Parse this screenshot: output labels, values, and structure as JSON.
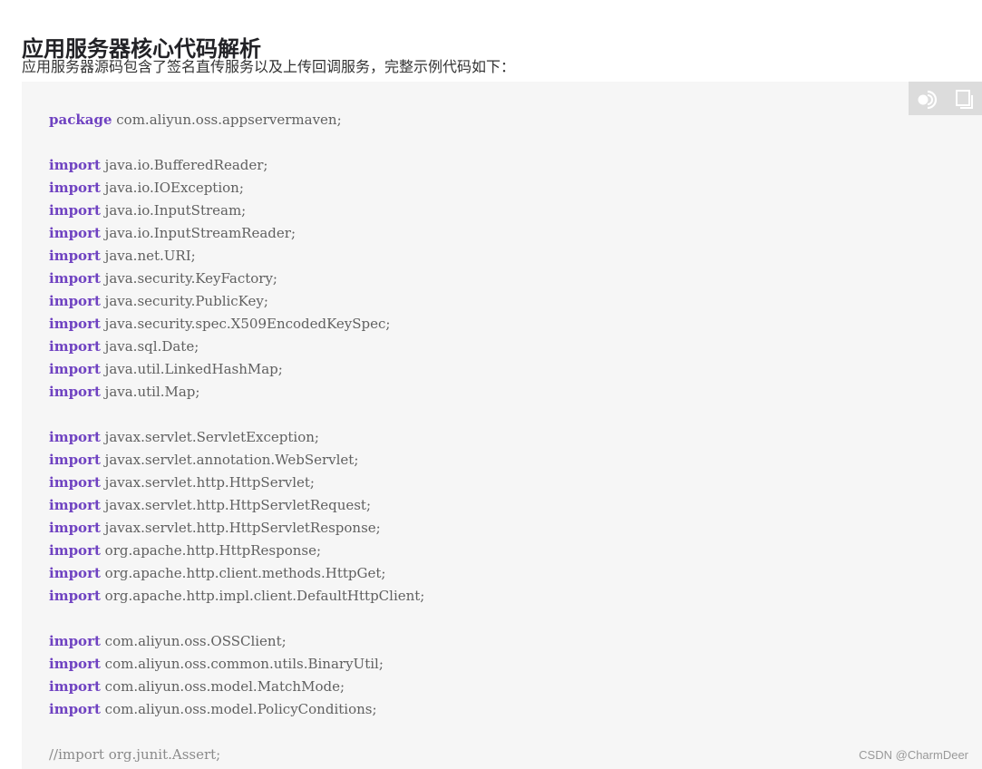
{
  "article": {
    "heading": "应用服务器核心代码解析",
    "intro": "应用服务器源码包含了签名直传服务以及上传回调服务，完整示例代码如下："
  },
  "code_block": {
    "language": "java",
    "toolbar": {
      "run_icon": "run-icon",
      "copy_icon": "copy-icon"
    },
    "colors": {
      "background": "#f6f6f6",
      "keyword": "#6f42c1",
      "text": "#606060",
      "comment": "#8a8a8a"
    },
    "lines": [
      {
        "keyword": "package",
        "text": " com.aliyun.oss.appservermaven;"
      },
      {
        "keyword": "",
        "text": ""
      },
      {
        "keyword": "import",
        "text": " java.io.BufferedReader;"
      },
      {
        "keyword": "import",
        "text": " java.io.IOException;"
      },
      {
        "keyword": "import",
        "text": " java.io.InputStream;"
      },
      {
        "keyword": "import",
        "text": " java.io.InputStreamReader;"
      },
      {
        "keyword": "import",
        "text": " java.net.URI;"
      },
      {
        "keyword": "import",
        "text": " java.security.KeyFactory;"
      },
      {
        "keyword": "import",
        "text": " java.security.PublicKey;"
      },
      {
        "keyword": "import",
        "text": " java.security.spec.X509EncodedKeySpec;"
      },
      {
        "keyword": "import",
        "text": " java.sql.Date;"
      },
      {
        "keyword": "import",
        "text": " java.util.LinkedHashMap;"
      },
      {
        "keyword": "import",
        "text": " java.util.Map;"
      },
      {
        "keyword": "",
        "text": ""
      },
      {
        "keyword": "import",
        "text": " javax.servlet.ServletException;"
      },
      {
        "keyword": "import",
        "text": " javax.servlet.annotation.WebServlet;"
      },
      {
        "keyword": "import",
        "text": " javax.servlet.http.HttpServlet;"
      },
      {
        "keyword": "import",
        "text": " javax.servlet.http.HttpServletRequest;"
      },
      {
        "keyword": "import",
        "text": " javax.servlet.http.HttpServletResponse;"
      },
      {
        "keyword": "import",
        "text": " org.apache.http.HttpResponse;"
      },
      {
        "keyword": "import",
        "text": " org.apache.http.client.methods.HttpGet;"
      },
      {
        "keyword": "import",
        "text": " org.apache.http.impl.client.DefaultHttpClient;"
      },
      {
        "keyword": "",
        "text": ""
      },
      {
        "keyword": "import",
        "text": " com.aliyun.oss.OSSClient;"
      },
      {
        "keyword": "import",
        "text": " com.aliyun.oss.common.utils.BinaryUtil;"
      },
      {
        "keyword": "import",
        "text": " com.aliyun.oss.model.MatchMode;"
      },
      {
        "keyword": "import",
        "text": " com.aliyun.oss.model.PolicyConditions;"
      },
      {
        "keyword": "",
        "text": ""
      },
      {
        "keyword": "",
        "text": "//import org.junit.Assert;",
        "comment": true
      }
    ]
  },
  "watermark": "CSDN @CharmDeer"
}
